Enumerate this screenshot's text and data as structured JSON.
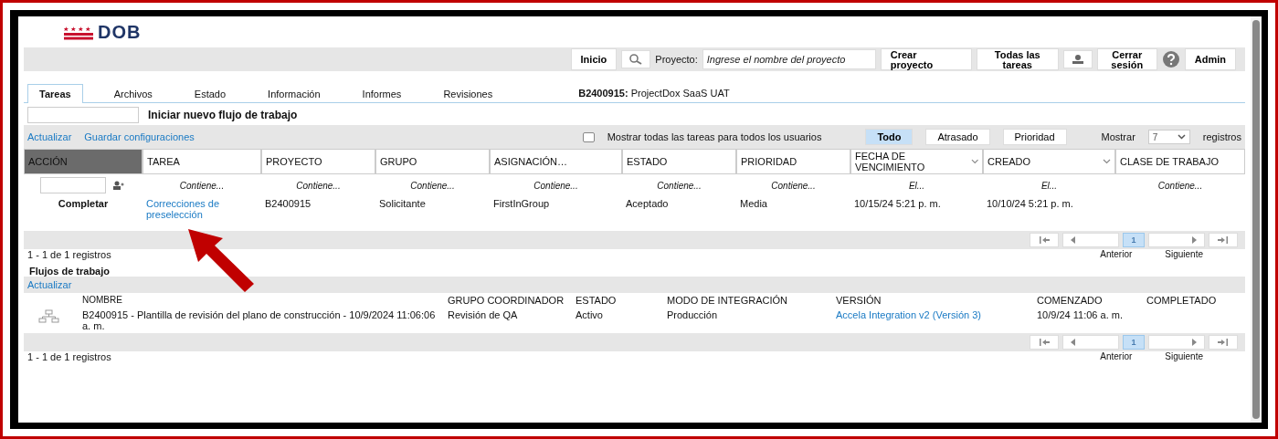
{
  "logo": {
    "text": "DOB"
  },
  "nav": {
    "home": "Inicio",
    "project_label": "Proyecto:",
    "project_placeholder": "Ingrese el nombre del proyecto",
    "create": "Crear proyecto",
    "all_tasks": "Todas las tareas",
    "logout": "Cerrar sesión",
    "admin": "Admin"
  },
  "tabs": [
    {
      "label": "Tareas",
      "selected": true
    },
    {
      "label": "Archivos",
      "selected": false
    },
    {
      "label": "Estado",
      "selected": false
    },
    {
      "label": "Información",
      "selected": false
    },
    {
      "label": "Informes",
      "selected": false
    },
    {
      "label": "Revisiones",
      "selected": false
    }
  ],
  "project_title": "**B2400915:** ProjectDox SaaS UAT",
  "new_workflow": "Iniciar nuevo flujo de trabajo",
  "toolbar": {
    "links": [
      "Actualizar",
      "Guardar configuraciones"
    ],
    "show_all": {
      "label": "Mostrar todas las tareas para todos los usuarios",
      "checked": false
    },
    "filters": [
      {
        "label": "Todo",
        "selected": true
      },
      {
        "label": "Atrasado",
        "selected": false
      },
      {
        "label": "Prioridad",
        "selected": false
      }
    ],
    "show": "Mostrar",
    "page_size": "7",
    "records": "registros"
  },
  "tasks": {
    "columns": [
      {
        "label": "ACCIÓN",
        "kind": "action"
      },
      {
        "label": "TAREA",
        "kind": "text",
        "filter": "Contiene..."
      },
      {
        "label": "PROYECTO",
        "kind": "text",
        "filter": "Contiene..."
      },
      {
        "label": "GRUPO",
        "kind": "text",
        "filter": "Contiene..."
      },
      {
        "label": "ASIGNACIÓN…",
        "kind": "text",
        "filter": "Contiene..."
      },
      {
        "label": "ESTADO",
        "kind": "text",
        "filter": "Contiene..."
      },
      {
        "label": "PRIORIDAD",
        "kind": "text",
        "filter": "Contiene..."
      },
      {
        "label": "FECHA DE VENCIMIENTO",
        "kind": "date",
        "filter": "El..."
      },
      {
        "label": "CREADO",
        "kind": "date",
        "filter": "El..."
      },
      {
        "label": "CLASE DE TRABAJO",
        "kind": "text",
        "filter": "Contiene..."
      }
    ],
    "rows": [
      {
        "cells": [
          {
            "kind": "action",
            "text": "Completar"
          },
          {
            "kind": "link",
            "text": "Correcciones de preselección"
          },
          {
            "kind": "text",
            "text": "B2400915"
          },
          {
            "kind": "text",
            "text": "Solicitante"
          },
          {
            "kind": "text",
            "text": "FirstInGroup"
          },
          {
            "kind": "text",
            "text": "Aceptado"
          },
          {
            "kind": "text",
            "text": "Media"
          },
          {
            "kind": "text",
            "text": "10/15/24 5:21 p. m."
          },
          {
            "kind": "text",
            "text": "10/10/24 5:21 p. m."
          },
          {
            "kind": "empty"
          }
        ]
      }
    ],
    "pager": {
      "pages": [
        {
          "label": "1",
          "selected": true
        }
      ],
      "prev": "Anterior",
      "next": "Siguiente"
    },
    "count": "1 - 1 de 1 registros"
  },
  "workflows": {
    "title": "Flujos de trabajo",
    "refresh": "Actualizar",
    "columns": [
      "NOMBRE",
      "GRUPO COORDINADOR",
      "ESTADO",
      "MODO DE INTEGRACIÓN",
      "VERSIÓN",
      "COMENZADO",
      "COMPLETADO"
    ],
    "rows": [
      {
        "cells": [
          {
            "kind": "text",
            "text": "B2400915 - Plantilla de revisión del plano de construcción - 10/9/2024 11:06:06 a. m."
          },
          {
            "kind": "text",
            "text": "Revisión de QA"
          },
          {
            "kind": "text",
            "text": "Activo"
          },
          {
            "kind": "text",
            "text": "Producción"
          },
          {
            "kind": "link",
            "text": "Accela Integration v2 (Versión 3)"
          },
          {
            "kind": "text",
            "text": "10/9/24 11:06 a. m."
          },
          {
            "kind": "empty"
          }
        ]
      }
    ],
    "pager": {
      "pages": [
        {
          "label": "1",
          "selected": true
        }
      ],
      "prev": "Anterior",
      "next": "Siguiente"
    },
    "count": "1 - 1 de 1 registros"
  }
}
